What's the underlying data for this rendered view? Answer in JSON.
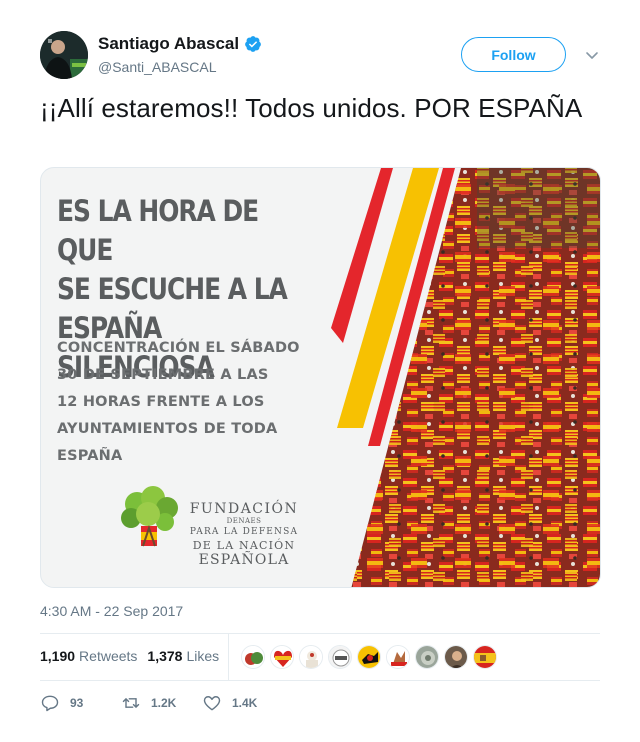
{
  "author": {
    "display_name": "Santiago Abascal",
    "handle": "@Santi_ABASCAL",
    "verified": true,
    "avatar_icon": "avatar-photo"
  },
  "follow_label": "Follow",
  "tweet": {
    "text": "¡¡Allí estaremos!! Todos unidos. POR ESPAÑA",
    "timestamp": "4:30 AM - 22 Sep 2017"
  },
  "media": {
    "headline": "ES LA HORA DE QUE\nSE ESCUCHE A LA\nESPAÑA SILENCIOSA",
    "body": "CONCENTRACIÓN EL SÁBADO\n30 DE SEPTIEMBRE A LAS\n12 HORAS FRENTE A LOS\nAYUNTAMIENTOS DE TODA\nESPAÑA",
    "logo": {
      "name": "FUNDACIÓN",
      "line1": "DENAES",
      "line2": "PARA LA DEFENSA",
      "line3": "DE LA NACIÓN",
      "line4": "ESPAÑOLA"
    },
    "colors": {
      "red": "#e4262c",
      "yellow": "#f7c102"
    }
  },
  "stats": {
    "retweets_count": "1,190",
    "retweets_label": "Retweets",
    "likes_count": "1,378",
    "likes_label": "Likes"
  },
  "actions": {
    "reply_count": "93",
    "retweet_count": "1.2K",
    "like_count": "1.4K"
  },
  "colors": {
    "accent": "#1da1f2",
    "muted": "#657786",
    "text": "#14171a"
  }
}
